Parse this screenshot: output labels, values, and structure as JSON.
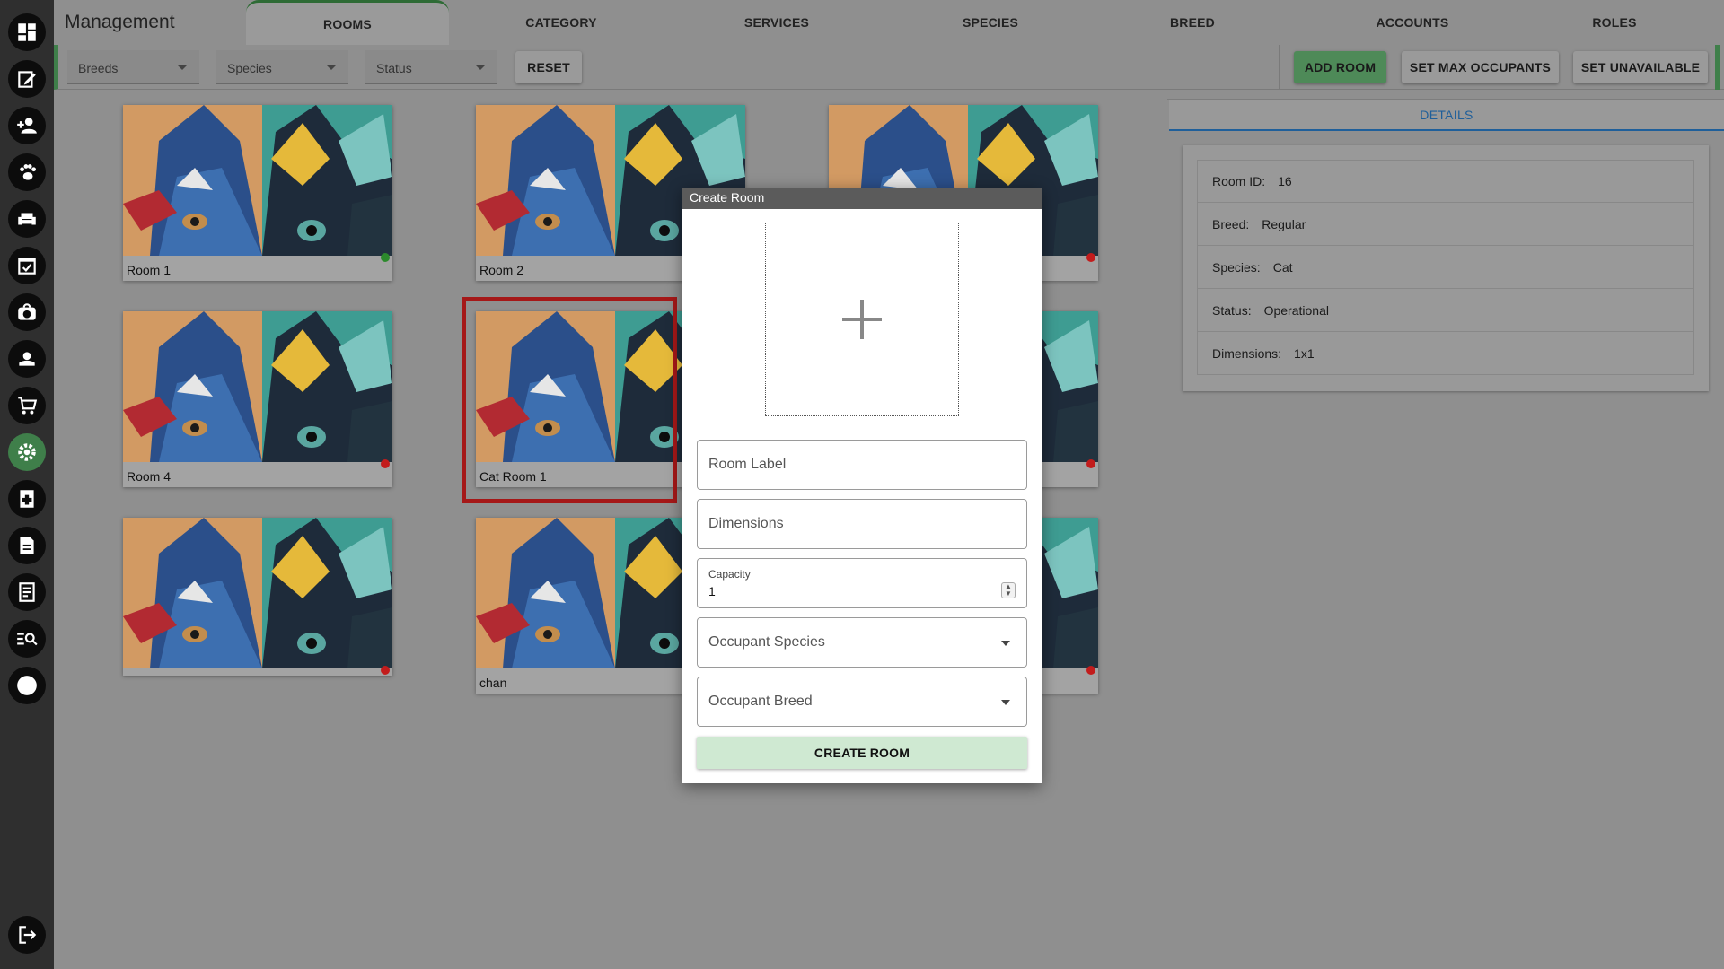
{
  "app": {
    "title": "Management"
  },
  "tabs": [
    {
      "label": "ROOMS",
      "active": true
    },
    {
      "label": "CATEGORY"
    },
    {
      "label": "SERVICES"
    },
    {
      "label": "SPECIES"
    },
    {
      "label": "BREED"
    },
    {
      "label": "ACCOUNTS"
    },
    {
      "label": "ROLES"
    }
  ],
  "filters": {
    "breeds_label": "Breeds",
    "species_label": "Species",
    "status_label": "Status",
    "reset_label": "RESET"
  },
  "actions": {
    "add_room": "ADD ROOM",
    "set_max_occupants": "SET MAX OCCUPANTS",
    "set_unavailable": "SET UNAVAILABLE"
  },
  "rooms": [
    {
      "label": "Room 1",
      "status": "green"
    },
    {
      "label": "Room 2",
      "status": "none"
    },
    {
      "label": "",
      "status": "red"
    },
    {
      "label": "Room 4",
      "status": "red"
    },
    {
      "label": "Cat Room 1",
      "status": "none",
      "selected": true
    },
    {
      "label": "",
      "status": "red"
    },
    {
      "label": "",
      "status": "red"
    },
    {
      "label": "chan",
      "status": "none"
    },
    {
      "label": "",
      "status": "red"
    }
  ],
  "details": {
    "tab_label": "DETAILS",
    "rows": [
      {
        "key": "Room ID:",
        "value": "16"
      },
      {
        "key": "Breed:",
        "value": "Regular"
      },
      {
        "key": "Species:",
        "value": "Cat"
      },
      {
        "key": "Status:",
        "value": "Operational"
      },
      {
        "key": "Dimensions:",
        "value": "1x1"
      }
    ]
  },
  "modal": {
    "title": "Create Room",
    "room_label_placeholder": "Room Label",
    "dimensions_placeholder": "Dimensions",
    "capacity_label": "Capacity",
    "capacity_value": "1",
    "occupant_species_placeholder": "Occupant Species",
    "occupant_breed_placeholder": "Occupant Breed",
    "create_button": "CREATE ROOM"
  },
  "colors": {
    "accent_green": "#3f7f4a",
    "status_red": "#c21c1c",
    "status_green": "#2c8a2c",
    "details_blue": "#1f5f9a"
  },
  "sidebar_icons": [
    "dashboard-icon",
    "edit-icon",
    "add-user-icon",
    "paw-icon",
    "sofa-icon",
    "calendar-check-icon",
    "pet-carrier-icon",
    "pet-care-icon",
    "cart-icon",
    "settings-icon",
    "medical-file-icon",
    "document-icon",
    "notes-icon",
    "search-list-icon",
    "circle-icon",
    "logout-icon"
  ]
}
